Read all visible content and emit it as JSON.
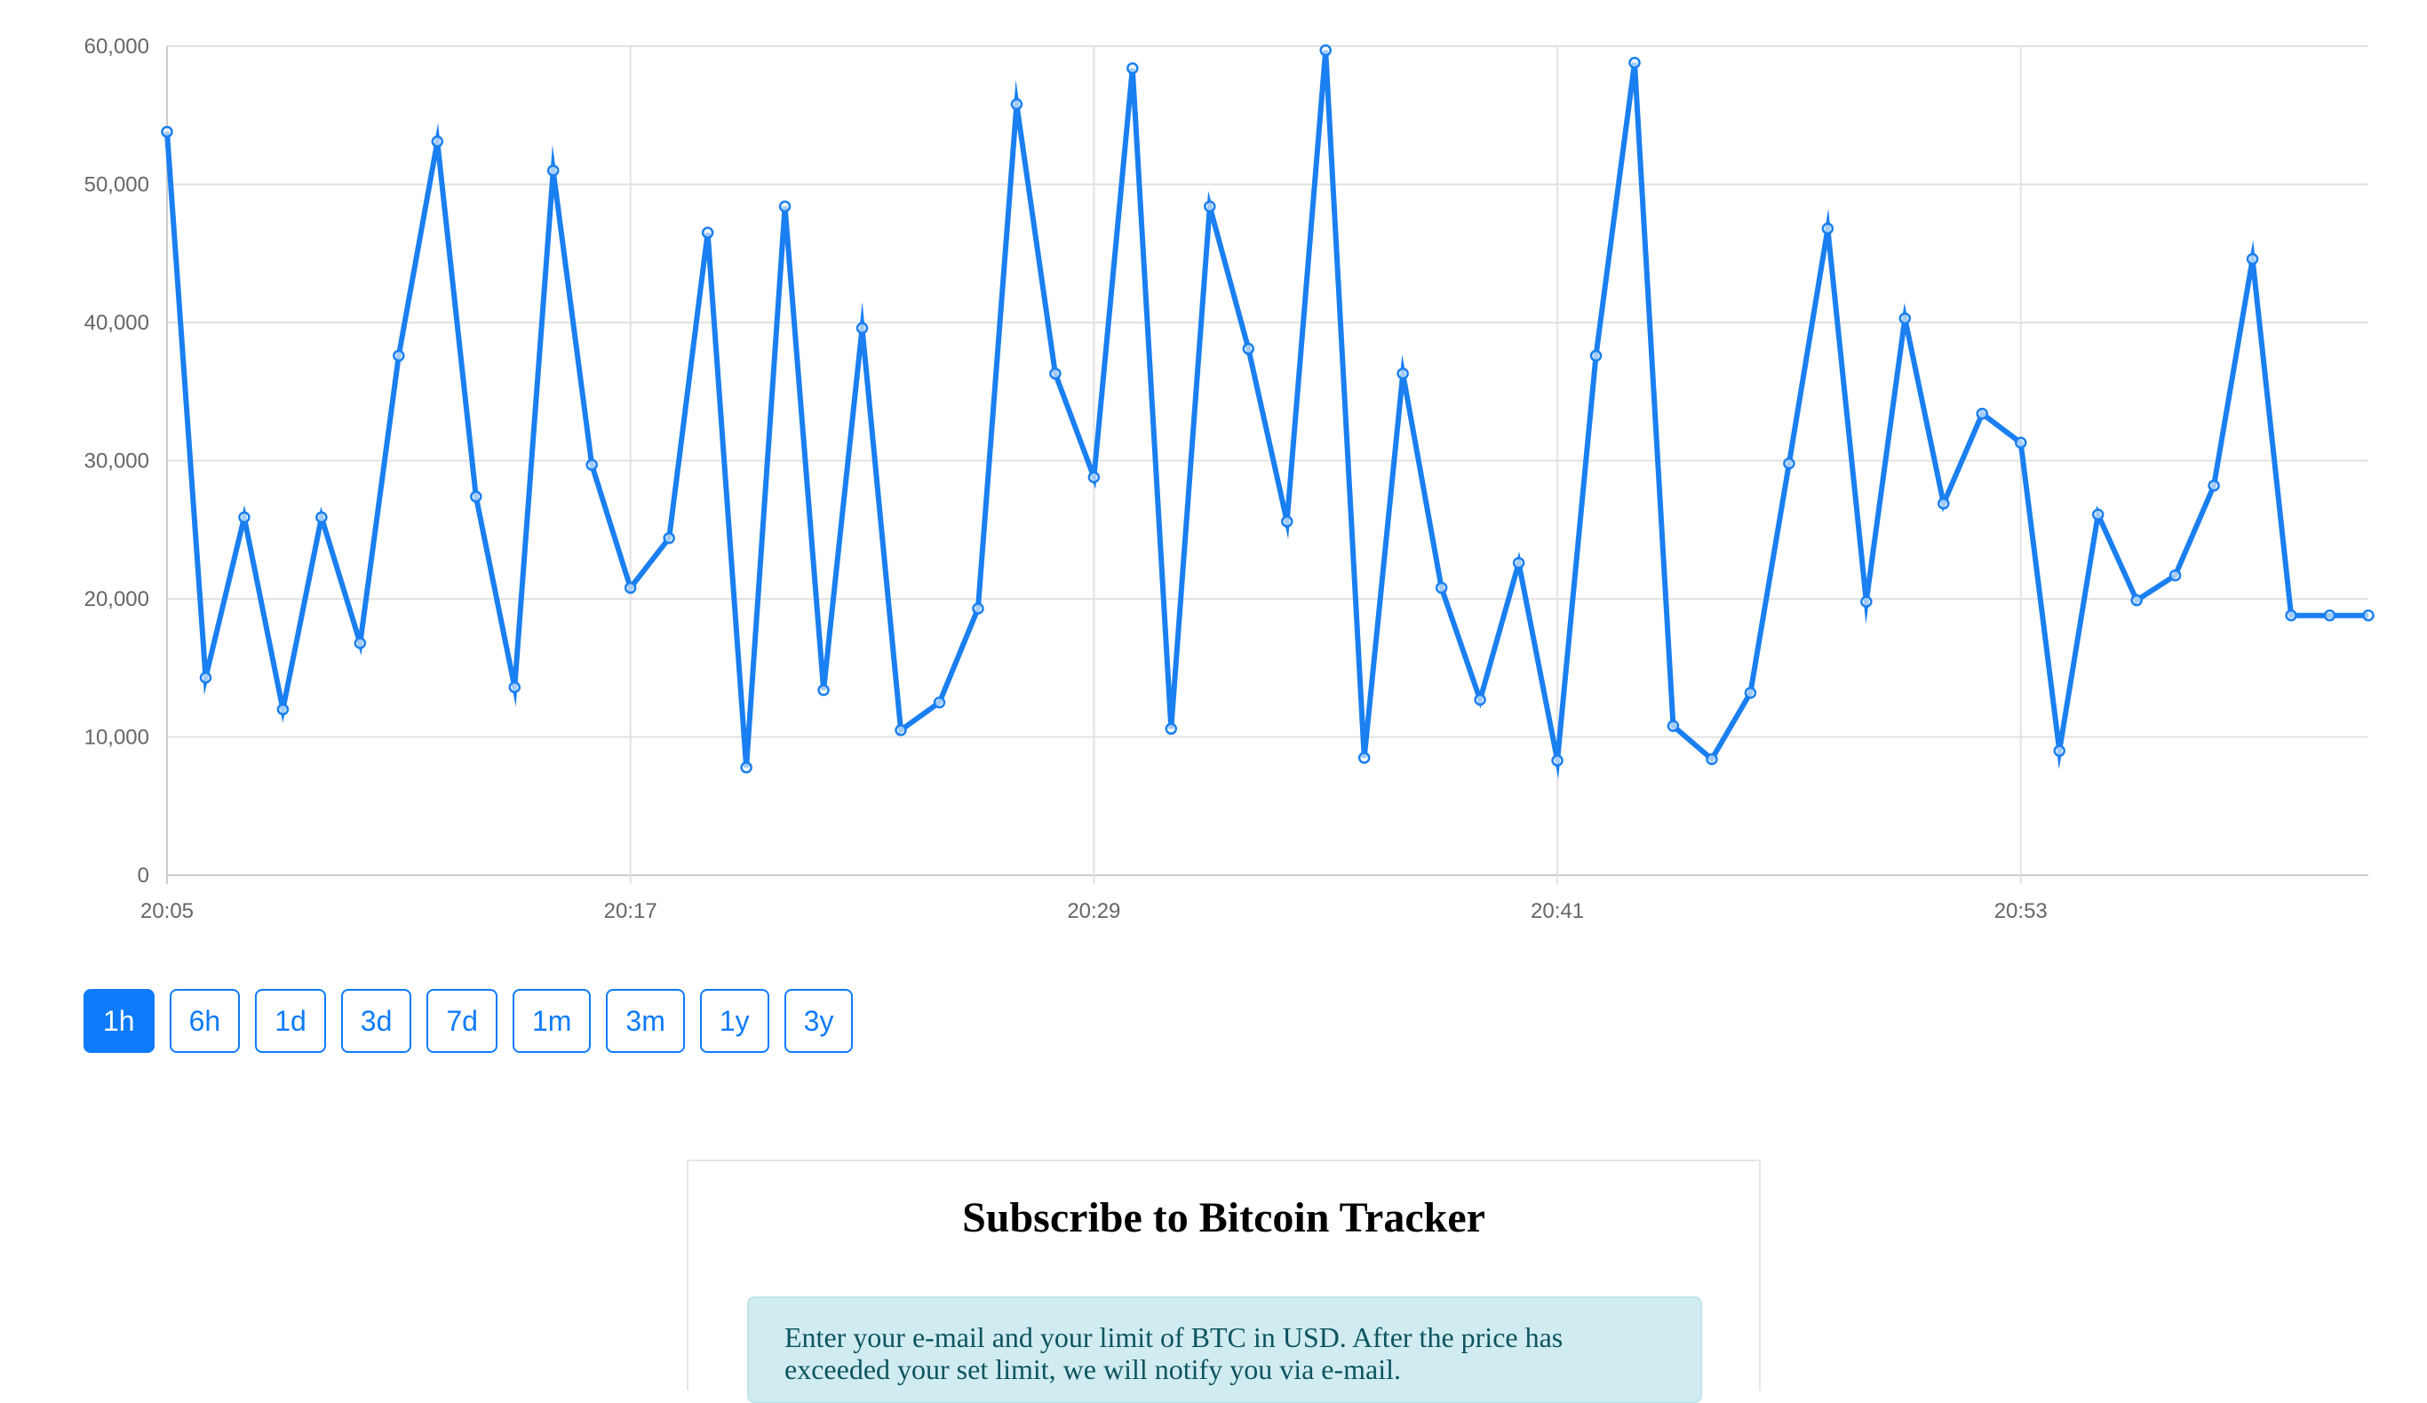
{
  "chart_data": {
    "type": "line",
    "title": "",
    "xlabel": "",
    "ylabel": "",
    "ylim": [
      0,
      60000
    ],
    "y_ticks": [
      "0",
      "10,000",
      "20,000",
      "30,000",
      "40,000",
      "50,000",
      "60,000"
    ],
    "x_tick_labels": [
      "20:05",
      "20:17",
      "20:29",
      "20:41",
      "20:53"
    ],
    "x": [
      "20:05",
      "20:06",
      "20:07",
      "20:08",
      "20:09",
      "20:10",
      "20:11",
      "20:12",
      "20:13",
      "20:14",
      "20:15",
      "20:16",
      "20:17",
      "20:18",
      "20:19",
      "20:20",
      "20:21",
      "20:22",
      "20:23",
      "20:24",
      "20:25",
      "20:26",
      "20:27",
      "20:28",
      "20:29",
      "20:30",
      "20:31",
      "20:32",
      "20:33",
      "20:34",
      "20:35",
      "20:36",
      "20:37",
      "20:38",
      "20:39",
      "20:40",
      "20:41",
      "20:42",
      "20:43",
      "20:44",
      "20:45",
      "20:46",
      "20:47",
      "20:48",
      "20:49",
      "20:50",
      "20:51",
      "20:52",
      "20:53",
      "20:54",
      "20:55",
      "20:56",
      "20:57",
      "20:58",
      "20:59",
      "21:00",
      "21:01",
      "21:02"
    ],
    "series": [
      {
        "values": [
          53800,
          14300,
          25900,
          12000,
          25900,
          16800,
          37600,
          53100,
          27400,
          13600,
          51000,
          29700,
          20800,
          24400,
          46500,
          7800,
          48400,
          13400,
          39600,
          10500,
          12500,
          19300,
          55800,
          36300,
          28800,
          58400,
          10600,
          48400,
          38100,
          25600,
          59700,
          8500,
          36300,
          20800,
          12700,
          22600,
          8300,
          37600,
          58800,
          10800,
          8400,
          13200,
          29800,
          46800,
          19800,
          40300,
          26900,
          33400,
          31300,
          9000,
          26100,
          19900,
          21700,
          28200,
          44600,
          18800,
          18800,
          18800
        ]
      }
    ],
    "grid": true,
    "legend": "none",
    "line_color": "#1a7ff0",
    "grid_color": "#e2e2e2",
    "axis_color": "#cccccc",
    "tick_label_color": "#666666"
  },
  "range_selector": {
    "options": [
      "1h",
      "6h",
      "1d",
      "3d",
      "7d",
      "1m",
      "3m",
      "1y",
      "3y"
    ],
    "selected": "1h"
  },
  "subscribe": {
    "title": "Subscribe to Bitcoin Tracker",
    "info_text": "Enter your e-mail and your limit of BTC in USD. After the price has exceeded your set limit, we will notify you via e-mail."
  }
}
